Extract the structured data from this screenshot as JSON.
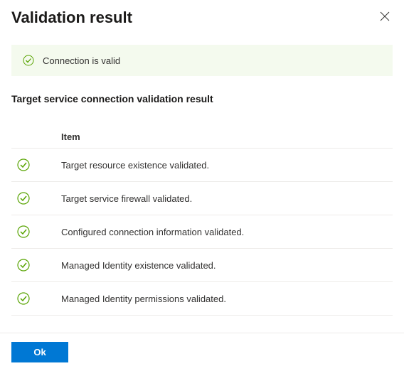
{
  "dialog": {
    "title": "Validation result"
  },
  "status": {
    "message": "Connection is valid"
  },
  "section": {
    "heading": "Target service connection validation result"
  },
  "table": {
    "header_item": "Item",
    "rows": [
      {
        "text": "Target resource existence validated."
      },
      {
        "text": "Target service firewall validated."
      },
      {
        "text": "Configured connection information validated."
      },
      {
        "text": "Managed Identity existence validated."
      },
      {
        "text": "Managed Identity permissions validated."
      }
    ]
  },
  "footer": {
    "ok_label": "Ok"
  }
}
